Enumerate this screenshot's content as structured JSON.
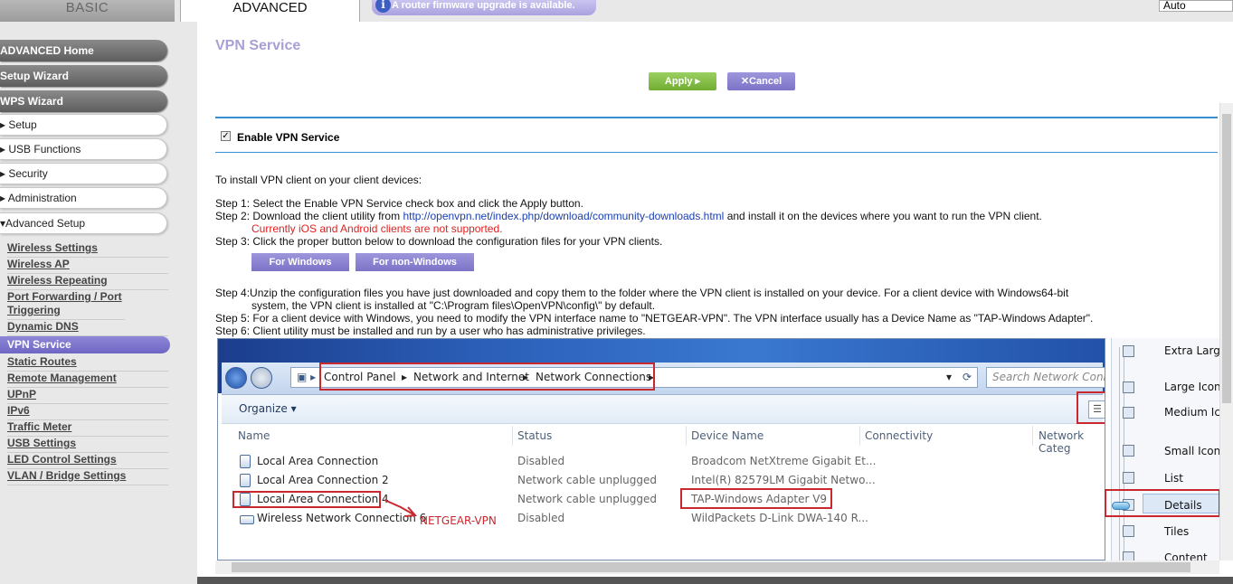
{
  "tabs": {
    "basic": "BASIC",
    "advanced": "ADVANCED"
  },
  "notice": "A router firmware upgrade is available.",
  "language_select": "Auto",
  "sidebar": {
    "dark_items": [
      "ADVANCED Home",
      "Setup Wizard",
      "WPS Wizard"
    ],
    "sections": [
      "▸ Setup",
      "▸ USB Functions",
      "▸ Security",
      "▸ Administration",
      "▾Advanced Setup"
    ],
    "links": [
      "Wireless Settings",
      "Wireless AP",
      "Wireless Repeating",
      "Port Forwarding / Port Triggering",
      "Dynamic DNS",
      "VPN Service",
      "Static Routes",
      "Remote Management",
      "UPnP",
      "IPv6",
      "Traffic Meter",
      "USB Settings",
      "LED Control Settings",
      "VLAN / Bridge Settings"
    ],
    "active": "VPN Service"
  },
  "page": {
    "title": "VPN Service",
    "apply": "Apply ▸",
    "cancel": "✕Cancel",
    "enable_label": "Enable VPN Service",
    "intro": "To install VPN client on your client devices:",
    "step1": "Step 1: Select the Enable VPN Service check box and click the Apply button.",
    "step2_prefix": "Step 2: Download the client utility from",
    "step2_link": "http://openvpn.net/index.php/download/community-downloads.html",
    "step2_suffix": "and install it on the devices where you want to run the VPN client.",
    "step2_note": "Currently iOS and Android clients are not supported.",
    "step3": "Step 3: Click the proper button below to download the configuration files for your VPN clients.",
    "btn_windows": "For Windows",
    "btn_non_windows": "For non-Windows",
    "step4a": "Step 4:Unzip the configuration files you have just downloaded and copy them to the folder where the VPN client is installed on your device. For a client device with Windows64-bit",
    "step4b": "system, the VPN client is installed at \"C:\\Program files\\OpenVPN\\config\\\" by default.",
    "step5": "Step 5: For a client device with Windows, you need to modify the VPN interface name to \"NETGEAR-VPN\". The VPN interface usually has a Device Name as \"TAP-Windows Adapter\".",
    "step6": "Step 6: Client utility must be installed and run by a user who has administrative privileges."
  },
  "explorer": {
    "breadcrumb": [
      "Control Panel",
      "Network and Internet",
      "Network Connections"
    ],
    "search_placeholder": "Search Network Connecti",
    "organize": "Organize ▾",
    "columns": [
      "Name",
      "Status",
      "Device Name",
      "Connectivity",
      "Network Categ"
    ],
    "rows": [
      {
        "name": "Local Area Connection",
        "status": "Disabled",
        "device": "Broadcom NetXtreme Gigabit Et..."
      },
      {
        "name": "Local Area Connection 2",
        "status": "Network cable unplugged",
        "device": "Intel(R) 82579LM Gigabit Netwo..."
      },
      {
        "name": "Local Area Connection 4",
        "status": "Network cable unplugged",
        "device": "TAP-Windows Adapter V9"
      },
      {
        "name": "Wireless Network Connection 6",
        "status": "Disabled",
        "device": "WildPackets D-Link DWA-140 R..."
      }
    ],
    "annotation": "NETGEAR-VPN",
    "view_menu": [
      "Extra Large",
      "Large Icons",
      "Medium Ico",
      "Small Icons",
      "List",
      "Details",
      "Tiles",
      "Content"
    ]
  },
  "colors": {
    "accent": "#a99fd6",
    "apply_green": "#71ad32",
    "cancel_purple": "#7c73c8",
    "rule_blue": "#3a8fd0",
    "annotation_red": "#c8282e"
  }
}
